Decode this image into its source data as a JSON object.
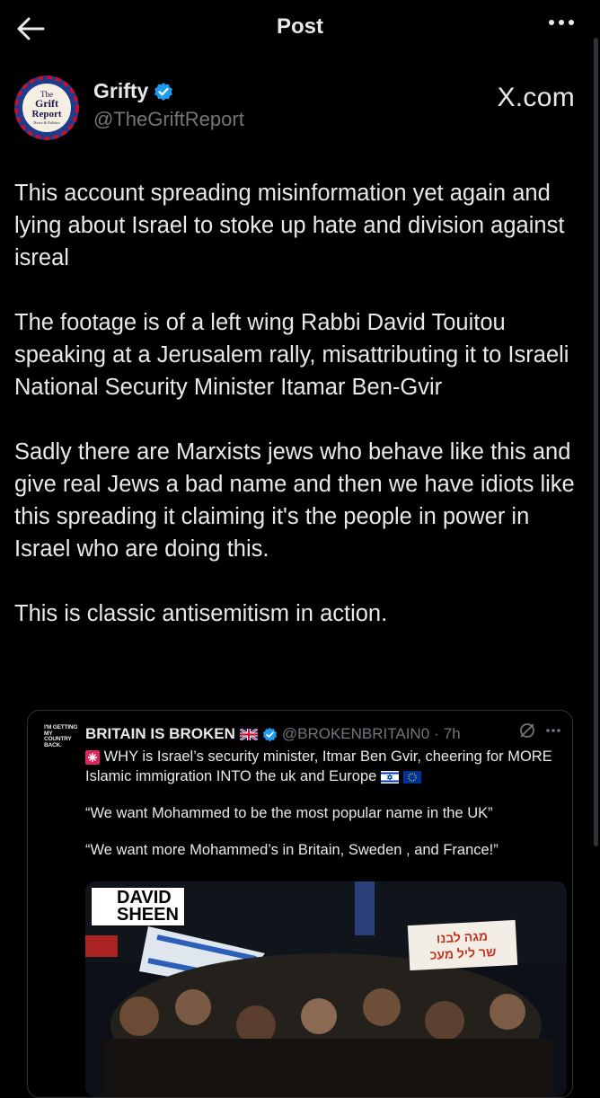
{
  "header": {
    "title": "Post"
  },
  "author": {
    "name": "Grifty",
    "handle": "@TheGriftReport",
    "avatar_text": [
      "The",
      "Grift",
      "Report",
      "News & Politics"
    ]
  },
  "source_label": "X.com",
  "post": {
    "paragraphs": [
      "This account spreading misinformation yet again and lying about Israel to stoke up hate and division against isreal",
      "The footage is of a left wing Rabbi David Touitou speaking at a Jerusalem rally, misattributing it to Israeli National Security Minister Itamar Ben-Gvir",
      "Sadly there are Marxists jews who behave like this and give real Jews a bad name and then we have idiots like this spreading it claiming it's the people in power in Israel who are doing this.",
      "This is classic antisemitism in action."
    ]
  },
  "quote": {
    "avatar_text": "I'M GETTING MY COUNTRY BACK.",
    "name": "BRITAIN IS BROKEN",
    "handle": "@BROKENBRITAIN0",
    "dot": "·",
    "time": "7h",
    "text_line1": "WHY is Israel’s security minister, Itmar Ben Gvir, cheering for MORE Islamic immigration INTO the uk and Europe",
    "quote1": "“We want Mohammed to be the most popular name in the UK”",
    "quote2": "“We want more Mohammed’s in Britain, Sweden , and France!”",
    "media": {
      "label_line1": "DAVID",
      "label_line2": "SHEEN",
      "sign_line1": "מגה לבנו",
      "sign_line2": "שר ליל מעכ"
    }
  },
  "colors": {
    "background": "#000000",
    "text": "#e7e9ea",
    "secondary": "#71767b",
    "verified": "#1d9bf0",
    "border": "#2f3336"
  }
}
